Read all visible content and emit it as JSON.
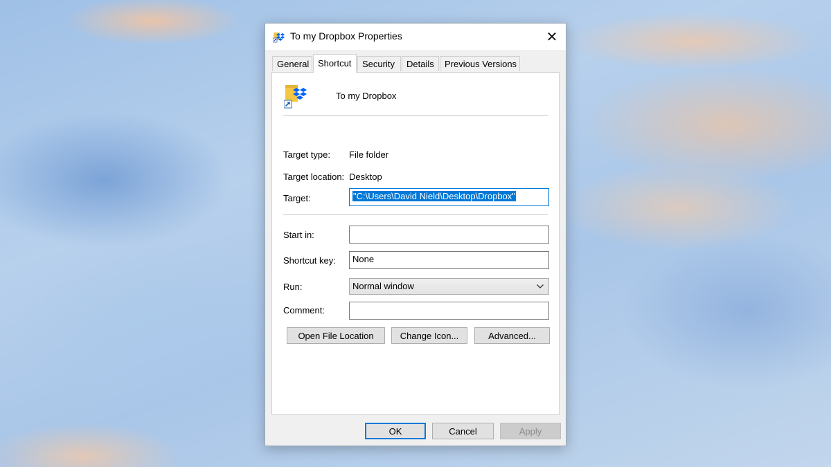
{
  "dialog": {
    "title": "To my Dropbox Properties",
    "close_glyph": "✕"
  },
  "tabs": [
    {
      "label": "General"
    },
    {
      "label": "Shortcut",
      "active": true
    },
    {
      "label": "Security"
    },
    {
      "label": "Details"
    },
    {
      "label": "Previous Versions"
    }
  ],
  "shortcut": {
    "name": "To my Dropbox",
    "target_type_label": "Target type:",
    "target_type_value": "File folder",
    "target_location_label": "Target location:",
    "target_location_value": "Desktop",
    "target_label": "Target:",
    "target_value": "\"C:\\Users\\David Nield\\Desktop\\Dropbox\"",
    "start_in_label": "Start in:",
    "start_in_value": "",
    "shortcut_key_label": "Shortcut key:",
    "shortcut_key_value": "None",
    "run_label": "Run:",
    "run_value": "Normal window",
    "comment_label": "Comment:",
    "comment_value": "",
    "buttons": {
      "open_file_location": "Open File Location",
      "change_icon": "Change Icon...",
      "advanced": "Advanced..."
    }
  },
  "footer": {
    "ok": "OK",
    "cancel": "Cancel",
    "apply": "Apply"
  },
  "icons": {
    "title": "dropbox-shortcut-icon",
    "large": "dropbox-folder-shortcut-icon",
    "close": "close-icon",
    "dropdown": "chevron-down-icon"
  },
  "colors": {
    "accent": "#0078d7",
    "dropbox_blue": "#0061fe",
    "folder_yellow": "#f3c744"
  }
}
